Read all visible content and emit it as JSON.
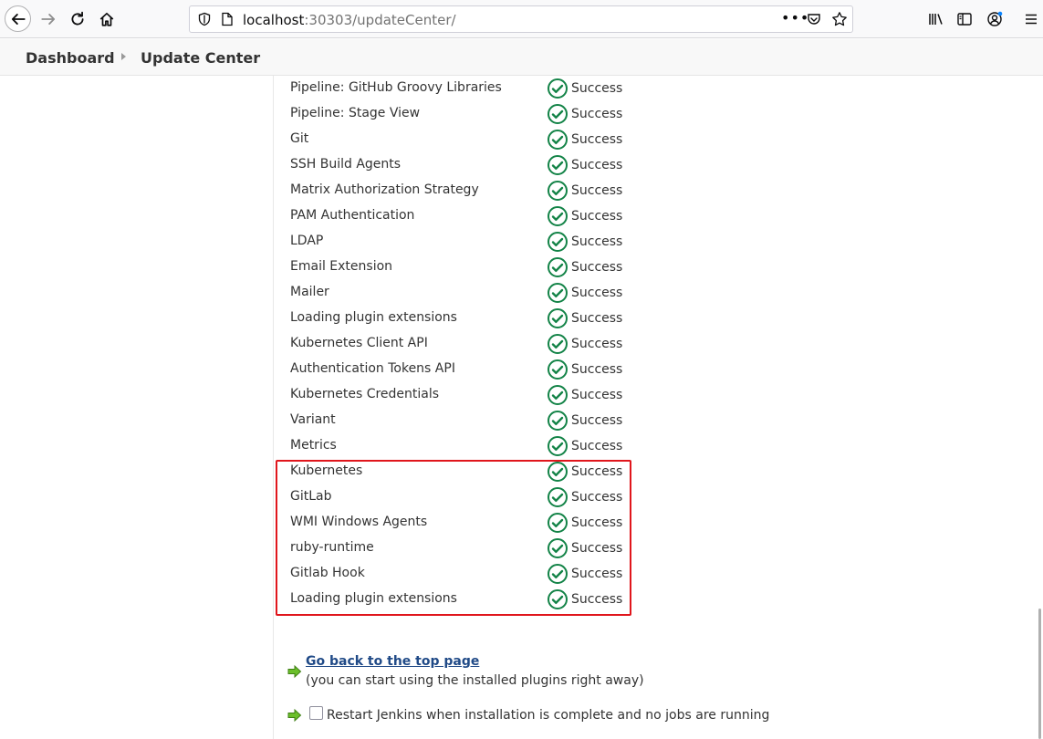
{
  "browser": {
    "url_host": "localhost",
    "url_rest": ":30303/updateCenter/"
  },
  "breadcrumb": {
    "items": [
      "Dashboard",
      "Update Center"
    ]
  },
  "plugins": [
    {
      "name": "Pipeline: GitHub Groovy Libraries",
      "status": "Success"
    },
    {
      "name": "Pipeline: Stage View",
      "status": "Success"
    },
    {
      "name": "Git",
      "status": "Success"
    },
    {
      "name": "SSH Build Agents",
      "status": "Success"
    },
    {
      "name": "Matrix Authorization Strategy",
      "status": "Success"
    },
    {
      "name": "PAM Authentication",
      "status": "Success"
    },
    {
      "name": "LDAP",
      "status": "Success"
    },
    {
      "name": "Email Extension",
      "status": "Success"
    },
    {
      "name": "Mailer",
      "status": "Success"
    },
    {
      "name": "Loading plugin extensions",
      "status": "Success"
    },
    {
      "name": "Kubernetes Client API",
      "status": "Success"
    },
    {
      "name": "Authentication Tokens API",
      "status": "Success"
    },
    {
      "name": "Kubernetes Credentials",
      "status": "Success"
    },
    {
      "name": "Variant",
      "status": "Success"
    },
    {
      "name": "Metrics",
      "status": "Success"
    },
    {
      "name": "Kubernetes",
      "status": "Success"
    },
    {
      "name": "GitLab",
      "status": "Success"
    },
    {
      "name": "WMI Windows Agents",
      "status": "Success"
    },
    {
      "name": "ruby-runtime",
      "status": "Success"
    },
    {
      "name": "Gitlab Hook",
      "status": "Success"
    },
    {
      "name": "Loading plugin extensions",
      "status": "Success"
    }
  ],
  "actions": {
    "go_back_label": "Go back to the top page",
    "go_back_note": "(you can start using the installed plugins right away)",
    "restart_label": "Restart Jenkins when installation is complete and no jobs are running",
    "restart_checked": false
  },
  "colors": {
    "success": "#138347",
    "highlight": "#e0161c",
    "arrow": "#6bbf2a"
  }
}
